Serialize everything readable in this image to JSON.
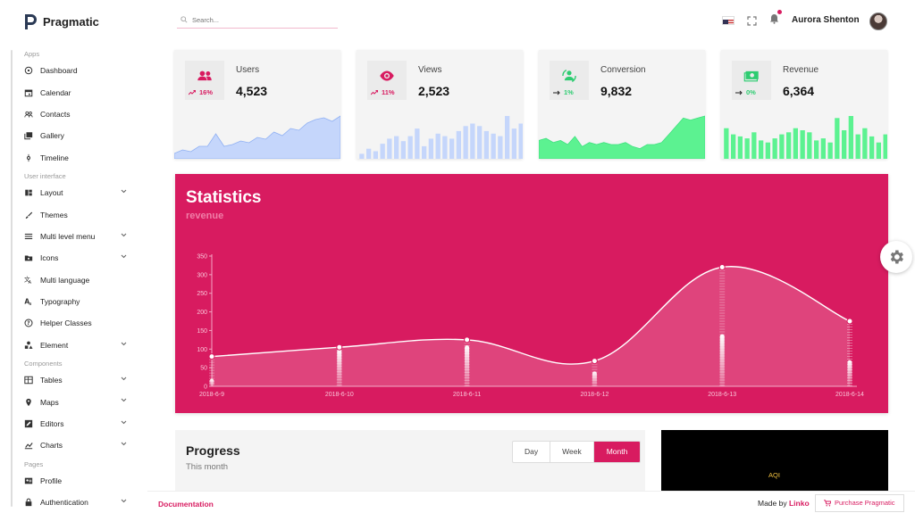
{
  "app": {
    "name": "Pragmatic"
  },
  "search": {
    "placeholder": "Search..."
  },
  "header": {
    "user_name": "Aurora Shenton"
  },
  "sidebar": {
    "sections": [
      {
        "title": "Apps",
        "items": [
          {
            "label": "Dashboard",
            "icon": "dashboard-icon",
            "chevron": false
          },
          {
            "label": "Calendar",
            "icon": "calendar-icon",
            "chevron": false
          },
          {
            "label": "Contacts",
            "icon": "contacts-icon",
            "chevron": false
          },
          {
            "label": "Gallery",
            "icon": "gallery-icon",
            "chevron": false
          },
          {
            "label": "Timeline",
            "icon": "timeline-icon",
            "chevron": false
          }
        ]
      },
      {
        "title": "User interface",
        "items": [
          {
            "label": "Layout",
            "icon": "layout-icon",
            "chevron": true
          },
          {
            "label": "Themes",
            "icon": "themes-icon",
            "chevron": false
          },
          {
            "label": "Multi level menu",
            "icon": "menu-icon",
            "chevron": true
          },
          {
            "label": "Icons",
            "icon": "icons-icon",
            "chevron": true
          },
          {
            "label": "Multi language",
            "icon": "translate-icon",
            "chevron": false
          },
          {
            "label": "Typography",
            "icon": "typography-icon",
            "chevron": false
          },
          {
            "label": "Helper Classes",
            "icon": "help-icon",
            "chevron": false
          },
          {
            "label": "Element",
            "icon": "element-icon",
            "chevron": true
          }
        ]
      },
      {
        "title": "Components",
        "items": [
          {
            "label": "Tables",
            "icon": "tables-icon",
            "chevron": true
          },
          {
            "label": "Maps",
            "icon": "maps-icon",
            "chevron": true
          },
          {
            "label": "Editors",
            "icon": "editors-icon",
            "chevron": true
          },
          {
            "label": "Charts",
            "icon": "charts-icon",
            "chevron": true
          }
        ]
      },
      {
        "title": "Pages",
        "items": [
          {
            "label": "Profile",
            "icon": "profile-icon",
            "chevron": false
          },
          {
            "label": "Authentication",
            "icon": "auth-icon",
            "chevron": true
          }
        ]
      }
    ]
  },
  "cards": [
    {
      "title": "Users",
      "value": "4,523",
      "change": "16%",
      "trend": "up",
      "icon": "users-icon",
      "color": "#d81b60",
      "spark_color": "#c5d6fb",
      "spark_type": "area",
      "spark": [
        3,
        5,
        4,
        7,
        7,
        14,
        7,
        8,
        10,
        9,
        12,
        11,
        15,
        13,
        17,
        16,
        20,
        22,
        23,
        21,
        24
      ]
    },
    {
      "title": "Views",
      "value": "2,523",
      "change": "11%",
      "trend": "up",
      "icon": "eye-icon",
      "color": "#d81b60",
      "spark_color": "#c5d6fb",
      "spark_type": "bar",
      "spark": [
        2,
        4,
        3,
        6,
        8,
        9,
        7,
        9,
        12,
        5,
        8,
        10,
        9,
        8,
        11,
        13,
        14,
        13,
        11,
        10,
        9,
        17,
        12,
        14
      ]
    },
    {
      "title": "Conversion",
      "value": "9,832",
      "change": "1%",
      "trend": "flat",
      "icon": "conversion-icon",
      "color": "#2ecc71",
      "spark_color": "#5cf291",
      "spark_type": "area",
      "spark": [
        9,
        10,
        8,
        9,
        7,
        11,
        6,
        8,
        7,
        8,
        7,
        7,
        8,
        6,
        5,
        7,
        7,
        8,
        12,
        16,
        20,
        19,
        20,
        21
      ]
    },
    {
      "title": "Revenue",
      "value": "6,364",
      "change": "0%",
      "trend": "flat",
      "icon": "money-icon",
      "color": "#2ecc71",
      "spark_color": "#5cf291",
      "spark_type": "bar",
      "spark": [
        15,
        12,
        11,
        10,
        13,
        9,
        8,
        10,
        12,
        13,
        15,
        14,
        13,
        9,
        10,
        8,
        20,
        14,
        21,
        12,
        15,
        11,
        8,
        12
      ]
    }
  ],
  "statistics": {
    "title": "Statistics",
    "subtitle": "revenue"
  },
  "chart_data": {
    "type": "line",
    "x": [
      "2018-6-9",
      "2018-6-10",
      "2018-6-11",
      "2018-6-12",
      "2018-6-13",
      "2018-6-14"
    ],
    "series": [
      {
        "values": [
          80,
          105,
          125,
          68,
          320,
          175
        ]
      },
      {
        "values": [
          20,
          100,
          110,
          40,
          140,
          70
        ]
      }
    ],
    "yticks": [
      0,
      50,
      100,
      150,
      200,
      250,
      300,
      350
    ],
    "ylim": [
      0,
      350
    ],
    "colors": {
      "background": "#d81b60",
      "line": "#ffffff"
    }
  },
  "progress": {
    "title": "Progress",
    "subtitle": "This month",
    "tabs": [
      "Day",
      "Week",
      "Month"
    ],
    "active_tab": "Month"
  },
  "aqi": {
    "label": "AQI"
  },
  "footer": {
    "documentation": "Documentation",
    "made_by_prefix": "Made by",
    "made_by_brand": "Linko",
    "purchase": "Purchase Pragmatic"
  },
  "theme": {
    "accent": "#d81b60",
    "green": "#2ecc71"
  }
}
